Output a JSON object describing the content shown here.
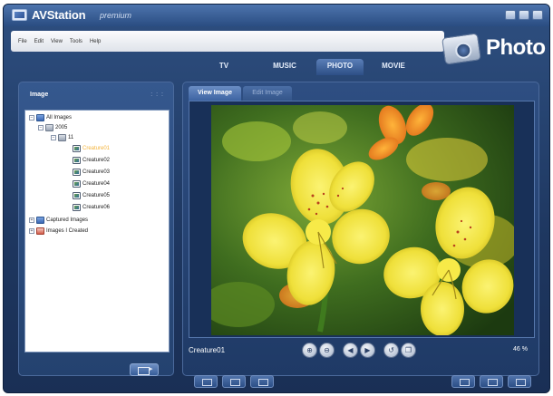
{
  "app": {
    "title": "AVStation",
    "edition": "premium",
    "section_badge": "Photo"
  },
  "menu": [
    "File",
    "Edit",
    "View",
    "Tools",
    "Help"
  ],
  "tabs": [
    {
      "label": "TV",
      "active": false
    },
    {
      "label": "MUSIC",
      "active": false
    },
    {
      "label": "PHOTO",
      "active": true
    },
    {
      "label": "MOVIE",
      "active": false
    }
  ],
  "left_panel": {
    "title": "Image",
    "tree": {
      "root": "All Images",
      "year": "2005",
      "month": "11",
      "files": [
        "Creature01",
        "Creature02",
        "Creature03",
        "Creature04",
        "Creature05",
        "Creature06"
      ],
      "selected": "Creature01",
      "captured": "Captured Images",
      "created": "Images I Created"
    }
  },
  "viewer": {
    "tabs": [
      "View Image",
      "Edit Image"
    ],
    "active_tab": "View Image",
    "filename": "Creature01",
    "zoom": "46 %",
    "controls": [
      "zoom-in",
      "zoom-out",
      "previous",
      "next",
      "rotate",
      "copy"
    ]
  },
  "colors": {
    "frame": "#1e3760",
    "accent": "#f4b33a",
    "flower": "#f2e53a"
  }
}
